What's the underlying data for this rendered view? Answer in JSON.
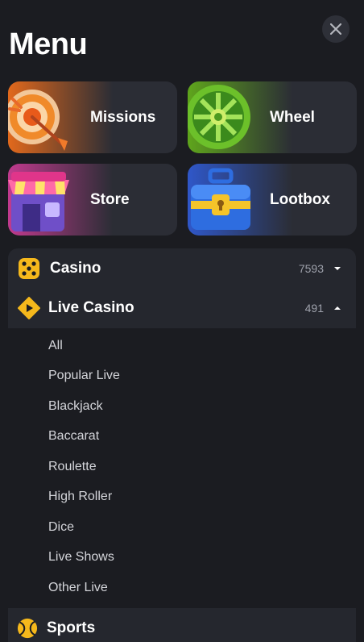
{
  "page": {
    "title": "Menu"
  },
  "tiles": [
    {
      "label": "Missions",
      "icon": "dart-target-icon"
    },
    {
      "label": "Wheel",
      "icon": "prize-wheel-icon"
    },
    {
      "label": "Store",
      "icon": "store-shop-icon"
    },
    {
      "label": "Lootbox",
      "icon": "lootbox-chest-icon"
    }
  ],
  "categories": {
    "casino": {
      "label": "Casino",
      "count": "7593",
      "icon": "dice-icon",
      "expanded": false
    },
    "live": {
      "label": "Live Casino",
      "count": "491",
      "icon": "play-diamond-icon",
      "expanded": true
    },
    "sports": {
      "label": "Sports",
      "icon": "tennis-ball-icon"
    }
  },
  "live_items": [
    "All",
    "Popular Live",
    "Blackjack",
    "Baccarat",
    "Roulette",
    "High Roller",
    "Dice",
    "Live Shows",
    "Other Live"
  ],
  "colors": {
    "background": "#1b1c21",
    "panel": "#25272e",
    "accent_yellow": "#f5b81c"
  }
}
